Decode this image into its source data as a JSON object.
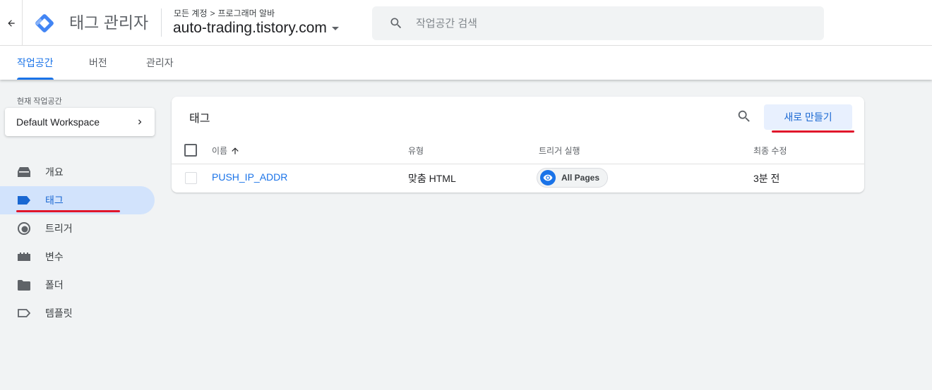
{
  "header": {
    "app_title": "태그 관리자",
    "breadcrumb": {
      "account": "모든 계정",
      "separator": ">",
      "container_group": "프로그래머 알바"
    },
    "container_name": "auto-trading.tistory.com",
    "search_placeholder": "작업공간 검색"
  },
  "tabs": [
    {
      "label": "작업공간",
      "active": true
    },
    {
      "label": "버전",
      "active": false
    },
    {
      "label": "관리자",
      "active": false
    }
  ],
  "sidebar": {
    "workspace_label": "현재 작업공간",
    "workspace_name": "Default Workspace",
    "items": [
      {
        "label": "개요",
        "icon": "overview-icon",
        "active": false
      },
      {
        "label": "태그",
        "icon": "tag-icon",
        "active": true
      },
      {
        "label": "트리거",
        "icon": "trigger-icon",
        "active": false
      },
      {
        "label": "변수",
        "icon": "variables-icon",
        "active": false
      },
      {
        "label": "폴더",
        "icon": "folder-icon",
        "active": false
      },
      {
        "label": "템플릿",
        "icon": "template-icon",
        "active": false
      }
    ]
  },
  "tags_panel": {
    "title": "태그",
    "new_button": "새로 만들기",
    "columns": {
      "name": "이름",
      "type": "유형",
      "trigger": "트리거 실행",
      "modified": "최종 수정"
    },
    "rows": [
      {
        "name": "PUSH_IP_ADDR",
        "type": "맞춤 HTML",
        "trigger": "All Pages",
        "modified": "3분 전"
      }
    ]
  },
  "colors": {
    "accent": "#1a73e8",
    "highlight": "#e0162b",
    "active_nav_bg": "#d2e3fc"
  }
}
